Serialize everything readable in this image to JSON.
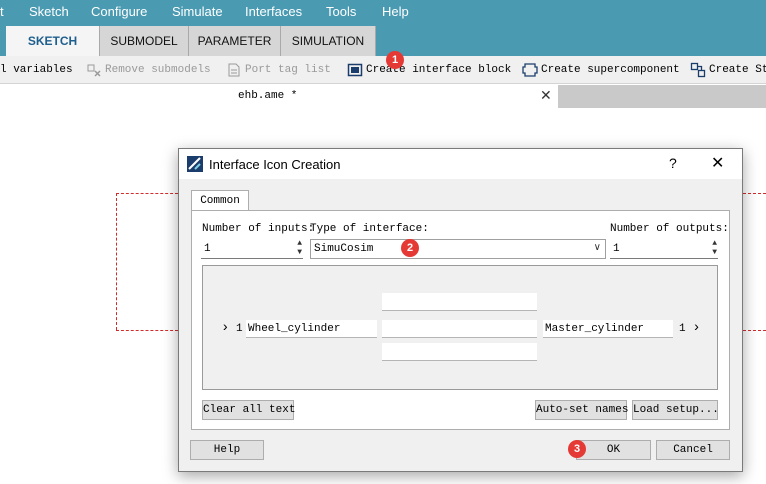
{
  "menubar": {
    "items": [
      "t",
      "Sketch",
      "Configure",
      "Simulate",
      "Interfaces",
      "Tools",
      "Help"
    ]
  },
  "tabs": [
    "SKETCH",
    "SUBMODEL",
    "PARAMETER",
    "SIMULATION"
  ],
  "active_tab": "SKETCH",
  "toolbar": {
    "variables_label": "l variables",
    "remove_submodels_label": "Remove submodels",
    "port_tag_list_label": "Port tag list",
    "create_interface_block_label": "Create interface block",
    "create_supercomponent_label": "Create supercomponent",
    "create_st_label": "Create St"
  },
  "document": {
    "tab_title": "ehb.ame *",
    "close_glyph": "✕"
  },
  "dialog": {
    "title": "Interface Icon Creation",
    "help_glyph": "?",
    "close_glyph": "✕",
    "tab_label": "Common",
    "inputs_label": "Number of inputs:",
    "inputs_value": "1",
    "interface_type_label": "Type of interface:",
    "interface_type_value": "SimuCosim",
    "outputs_label": "Number of outputs:",
    "outputs_value": "1",
    "input_port_number": "1",
    "input_port_name": "Wheel_cylinder",
    "output_port_name": "Master_cylinder",
    "output_port_number": "1",
    "center_fields": [
      "",
      "",
      ""
    ],
    "buttons": {
      "clear_all_text": "Clear all text",
      "auto_set_names": "Auto-set names",
      "load_setup": "Load setup...",
      "help": "Help",
      "ok": "OK",
      "cancel": "Cancel"
    }
  },
  "badges": [
    "1",
    "2",
    "3"
  ],
  "colors": {
    "header_bg": "#4a9ab2",
    "badge": "#e53935",
    "dashed_line": "#d22b2b",
    "active_tab_text": "#1e5f8e"
  }
}
